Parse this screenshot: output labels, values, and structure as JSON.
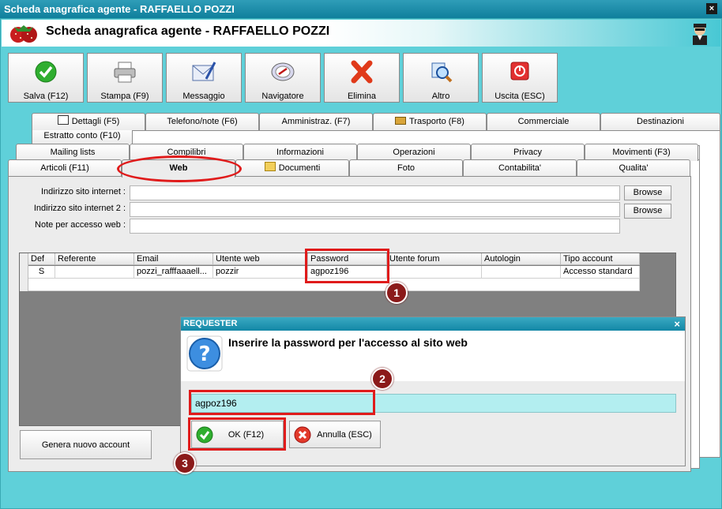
{
  "window": {
    "title": "Scheda anagrafica agente - RAFFAELLO POZZI",
    "close_glyph": "×"
  },
  "header": {
    "title": "Scheda anagrafica agente - RAFFAELLO POZZI"
  },
  "toolbar": [
    {
      "label": "Salva (F12)",
      "icon": "check-icon"
    },
    {
      "label": "Stampa (F9)",
      "icon": "printer-icon"
    },
    {
      "label": "Messaggio",
      "icon": "message-icon"
    },
    {
      "label": "Navigatore",
      "icon": "compass-icon"
    },
    {
      "label": "Elimina",
      "icon": "delete-icon"
    },
    {
      "label": "Altro",
      "icon": "search-icon"
    },
    {
      "label": "Uscita (ESC)",
      "icon": "exit-icon"
    }
  ],
  "tabs": {
    "row1": [
      "Estratto conto (F10)"
    ],
    "row2": [
      "Dettagli (F5)",
      "Telefono/note (F6)",
      "Amministraz. (F7)",
      "Trasporto (F8)",
      "Commerciale",
      "Destinazioni"
    ],
    "row3": [
      "Mailing lists",
      "Compilibri",
      "Informazioni",
      "Operazioni",
      "Privacy",
      "Movimenti (F3)"
    ],
    "row4": [
      "Articoli (F11)",
      "Web",
      "Documenti",
      "Foto",
      "Contabilita'",
      "Qualita'"
    ],
    "selected": "Web"
  },
  "form": {
    "site_label": "Indirizzo sito internet :",
    "site2_label": "Indirizzo sito internet 2 :",
    "notes_label": "Note per accesso web :",
    "site_value": "",
    "site2_value": "",
    "notes_value": "",
    "browse1": "Browse",
    "browse2": "Browse"
  },
  "grid": {
    "columns": [
      "Def",
      "Referente",
      "Email",
      "Utente web",
      "Password",
      "Utente forum",
      "Autologin",
      "Tipo account"
    ],
    "rows": [
      [
        "S",
        "",
        "pozzi_rafffaaaell...",
        "pozzir",
        "agpoz196",
        "",
        "",
        "Accesso standard"
      ]
    ]
  },
  "generate_button": "Genera nuovo account",
  "requester": {
    "title": "REQUESTER",
    "close_glyph": "×",
    "message": "Inserire la password per l'accesso al sito web",
    "value": "agpoz196",
    "ok_label": "OK (F12)",
    "cancel_label": "Annulla (ESC)"
  },
  "annotations": [
    "1",
    "2",
    "3"
  ],
  "colors": {
    "accent": "#5fd0d9",
    "highlight": "#e01b1b",
    "badge": "#8b1a1a",
    "input_active": "#b3eef0"
  }
}
